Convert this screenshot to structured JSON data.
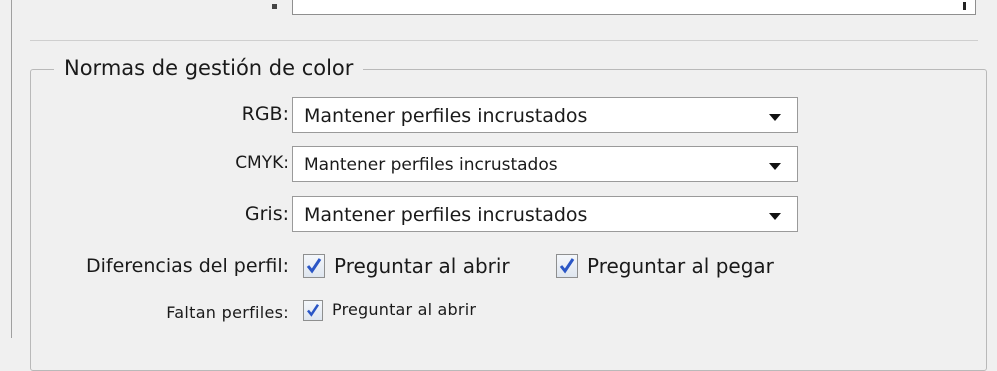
{
  "group": {
    "title": "Normas de gestión de color"
  },
  "rgb": {
    "label": "RGB:",
    "value": "Mantener perfiles incrustados"
  },
  "cmyk": {
    "label": "CMYK:",
    "value": "Mantener perfiles incrustados"
  },
  "gris": {
    "label": "Gris:",
    "value": "Mantener perfiles incrustados"
  },
  "diferencias": {
    "label": "Diferencias del perfil:",
    "ask_open": {
      "label": "Preguntar al abrir",
      "checked": true
    },
    "ask_paste": {
      "label": "Preguntar al pegar",
      "checked": true
    }
  },
  "faltan": {
    "label": "Faltan perfiles:",
    "ask_open": {
      "label": "Preguntar al abrir",
      "checked": true
    }
  },
  "colors": {
    "checkmark": "#2a56c6",
    "background": "#f0f0f0"
  }
}
